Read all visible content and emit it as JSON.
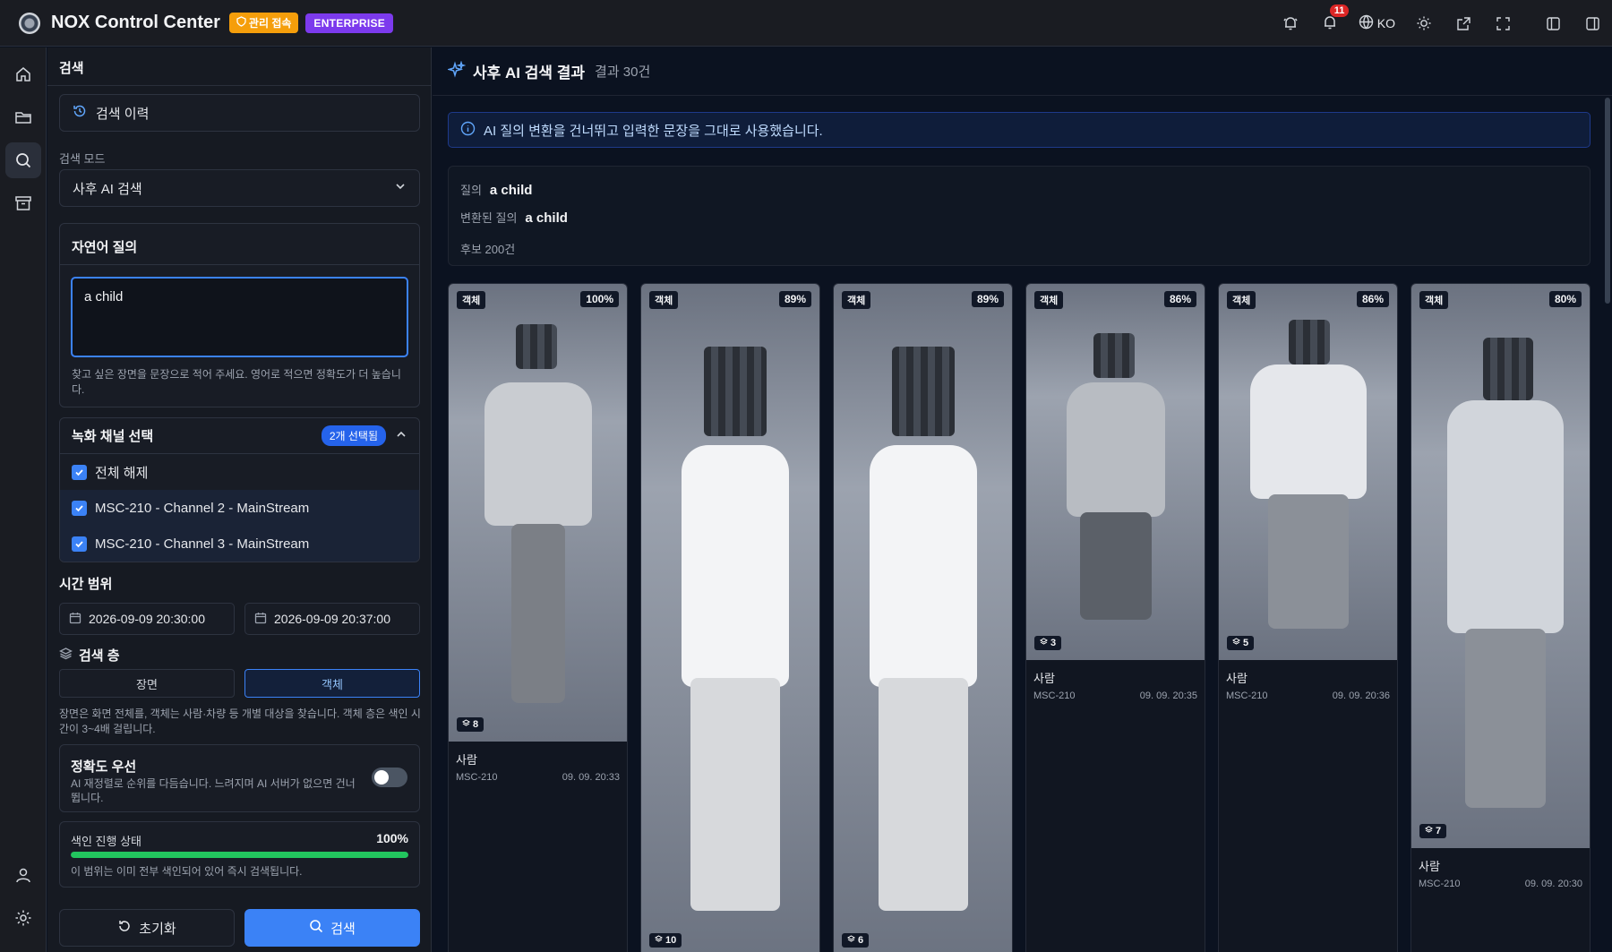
{
  "app": {
    "title": "NOX Control Center",
    "admin_badge": "관리 접속",
    "edition_badge": "ENTERPRISE"
  },
  "topbar": {
    "notification_count": "11",
    "language": "KO"
  },
  "panel": {
    "title": "검색",
    "history_label": "검색 이력",
    "mode_label": "검색 모드",
    "mode_value": "사후 AI 검색",
    "nlq_title": "자연어 질의",
    "nlq_value": "a child",
    "nlq_hint": "찾고 싶은 장면을 문장으로 적어 주세요. 영어로 적으면 정확도가 더 높습니다.",
    "channels_title": "녹화 채널 선택",
    "channels_selected": "2개 선택됨",
    "deselect_all": "전체 해제",
    "channels": [
      "MSC-210 - Channel 2 - MainStream",
      "MSC-210 - Channel 3 - MainStream"
    ],
    "time_title": "시간 범위",
    "time_start": "2026-09-09 20:30:00",
    "time_end": "2026-09-09 20:37:00",
    "layer_title": "검색 층",
    "layer_scene": "장면",
    "layer_object": "객체",
    "layer_hint": "장면은 화면 전체를, 객체는 사람·차량 등 개별 대상을 찾습니다. 객체 층은 색인 시간이 3~4배 걸립니다.",
    "accuracy_title": "정확도 우선",
    "accuracy_desc": "AI 재정렬로 순위를 다듬습니다. 느려지며 AI 서버가 없으면 건너뜁니다.",
    "accuracy_on": false,
    "index_title": "색인 진행 상태",
    "index_value": "100%",
    "index_progress": 1.0,
    "index_desc": "이 범위는 이미 전부 색인되어 있어 즉시 검색됩니다.",
    "reset_label": "초기화",
    "search_label": "검색"
  },
  "main": {
    "title": "사후 AI 검색 결과",
    "count": "결과 30건",
    "info": "AI 질의 변환을 건너뛰고 입력한 문장을 그대로 사용했습니다.",
    "query_key": "질의",
    "query_value": "a child",
    "transformed_key": "변환된 질의",
    "transformed_value": "a child",
    "candidates": "후보 200건"
  },
  "results": [
    {
      "tag": "객체",
      "score": "100%",
      "frames": "8",
      "type": "사람",
      "camera": "MSC-210",
      "time": "09. 09. 20:33"
    },
    {
      "tag": "객체",
      "score": "89%",
      "frames": "10",
      "type": "",
      "camera": "",
      "time": ""
    },
    {
      "tag": "객체",
      "score": "89%",
      "frames": "6",
      "type": "",
      "camera": "",
      "time": ""
    },
    {
      "tag": "객체",
      "score": "86%",
      "frames": "3",
      "type": "사람",
      "camera": "MSC-210",
      "time": "09. 09. 20:35"
    },
    {
      "tag": "객체",
      "score": "86%",
      "frames": "5",
      "type": "사람",
      "camera": "MSC-210",
      "time": "09. 09. 20:36"
    },
    {
      "tag": "객체",
      "score": "80%",
      "frames": "7",
      "type": "사람",
      "camera": "MSC-210",
      "time": "09. 09. 20:30"
    }
  ],
  "colors": {
    "accent": "#3b82f6",
    "admin": "#f59e0b",
    "enterprise": "#7c3aed",
    "progress": "#22c55e"
  }
}
